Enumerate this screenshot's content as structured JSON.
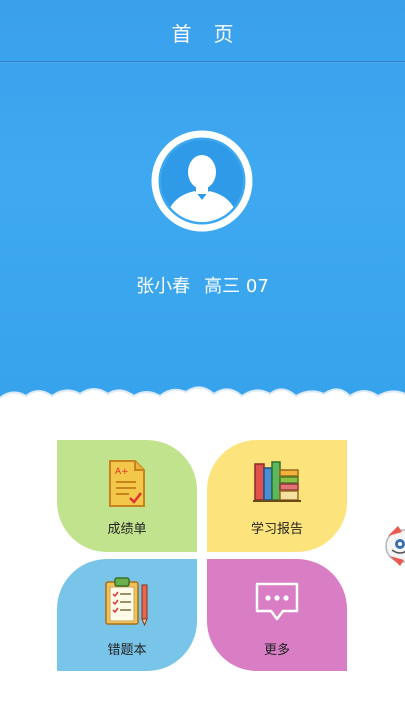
{
  "header": {
    "title": "首页"
  },
  "profile": {
    "name": "张小春",
    "class": "高三 07"
  },
  "menu": {
    "tiles": [
      {
        "label": "成绩单",
        "icon": "report-card-icon",
        "color": "#c2e38e"
      },
      {
        "label": "学习报告",
        "icon": "books-icon",
        "color": "#fde37c"
      },
      {
        "label": "错题本",
        "icon": "clipboard-checklist-icon",
        "color": "#79c5ea"
      },
      {
        "label": "更多",
        "icon": "chat-bubble-dots-icon",
        "color": "#d97dc5"
      }
    ]
  },
  "colors": {
    "hero": "#3ea9f0",
    "background": "#ffffff"
  }
}
